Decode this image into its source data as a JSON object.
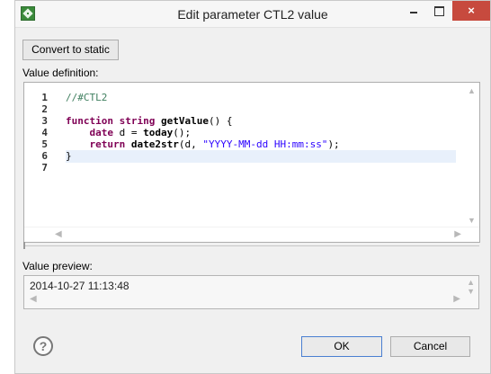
{
  "window": {
    "title": "Edit parameter CTL2 value",
    "close_glyph": "×"
  },
  "toolbar": {
    "convert_label": "Convert to static"
  },
  "editor": {
    "label": "Value definition:",
    "line_numbers": [
      "1",
      "2",
      "3",
      "4",
      "5",
      "6",
      "7"
    ],
    "lines": [
      {
        "comment": "//#CTL2"
      },
      {},
      {
        "kw1": "function string ",
        "fn": "getValue",
        "rest": "() {"
      },
      {
        "indent": "    ",
        "kw1": "date",
        "rest": " d = ",
        "fn": "today",
        "rest2": "();"
      },
      {
        "indent": "    ",
        "kw1": "return",
        "rest": " ",
        "fn": "date2str",
        "rest2": "(d, ",
        "str": "\"YYYY-MM-dd HH:mm:ss\"",
        "rest3": ");"
      },
      {
        "rest": "}"
      },
      {}
    ],
    "highlighted_line": 5
  },
  "preview": {
    "label": "Value preview:",
    "value": "2014-10-27 11:13:48"
  },
  "footer": {
    "help_glyph": "?",
    "ok_label": "OK",
    "cancel_label": "Cancel"
  },
  "colors": {
    "keyword": "#7f0055",
    "comment": "#3f7f5f",
    "string": "#2a00ff",
    "close_button": "#c74a3e",
    "highlight": "#e8f0fb"
  },
  "icons": {
    "app": "cloveretl-app-icon",
    "help": "help-icon",
    "minimize": "minimize-icon",
    "maximize": "maximize-icon",
    "close": "close-icon"
  }
}
